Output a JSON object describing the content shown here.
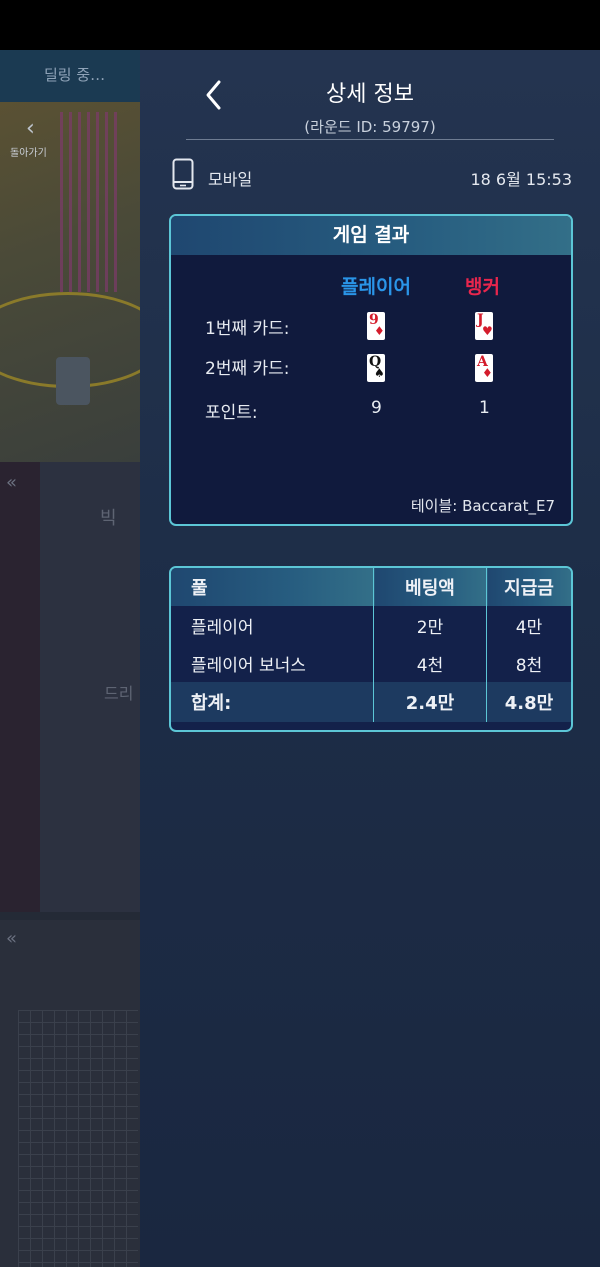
{
  "background_app": {
    "top_label": "딜링 중…",
    "back_label": "돌아가기",
    "panel_text_1": "빅",
    "panel_text_2": "드리"
  },
  "detail": {
    "title": "상세 정보",
    "round_id": "(라운드 ID: 59797)",
    "device": {
      "icon": "mobile-phone-icon",
      "label": "모바일"
    },
    "datetime": "18  6월 15:53"
  },
  "game_result": {
    "header": "게임 결과",
    "player_label": "플레이어",
    "banker_label": "뱅커",
    "rows": {
      "card1_label": "1번째  카드:",
      "card2_label": "2번째 카드:",
      "points_label": "포인트:"
    },
    "player_cards": [
      {
        "rank": "9",
        "suit": "♦"
      },
      {
        "rank": "Q",
        "suit": "♠"
      }
    ],
    "banker_cards": [
      {
        "rank": "J",
        "suit": "♥"
      },
      {
        "rank": "A",
        "suit": "♦"
      }
    ],
    "player_points": "9",
    "banker_points": "1",
    "table": "테이블: Baccarat_E7"
  },
  "bets": {
    "headers": {
      "pool": "풀",
      "bet": "베팅액",
      "payout": "지급금"
    },
    "rows": [
      {
        "pool": "플레이어",
        "bet": "2만",
        "payout": "4만"
      },
      {
        "pool": "플레이어 보너스",
        "bet": "4천",
        "payout": "8천"
      }
    ],
    "total": {
      "label": "합계:",
      "bet": "2.4만",
      "payout": "4.8만"
    }
  },
  "colors": {
    "accent_border": "#5cc6d6",
    "player": "#2a95e8",
    "banker": "#e8264d"
  }
}
